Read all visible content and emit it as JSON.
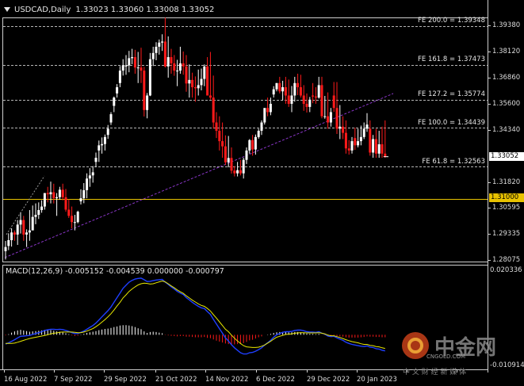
{
  "chart": {
    "symbol_timeframe": "USDCAD,Daily",
    "ohlc": "1.33023 1.33060 1.33008 1.33052"
  },
  "price_axis": {
    "ticks": [
      "1.39380",
      "1.38120",
      "1.36860",
      "1.35600",
      "1.34340",
      "1.31820",
      "1.30595",
      "1.29335",
      "1.28075"
    ],
    "current_price": "1.33052",
    "level_price": "1.31000"
  },
  "fibonacci": [
    {
      "label": "FE 200.0 = 1.39348",
      "price": 1.39348
    },
    {
      "label": "FE 161.8 = 1.37473",
      "price": 1.37473
    },
    {
      "label": "FE 127.2 = 1.35774",
      "price": 1.35774
    },
    {
      "label": "FE 100.0 = 1.34439",
      "price": 1.34439
    },
    {
      "label": "FE 61.8 = 1.32563",
      "price": 1.32563
    }
  ],
  "macd": {
    "label": "MACD(12,26,9) -0.005152 -0.004539 0.000000 -0.000797",
    "top_value": "0.020336",
    "bottom_value": "-0.010914"
  },
  "time_axis": [
    "16 Aug 2022",
    "7 Sep 2022",
    "29 Sep 2022",
    "21 Oct 2022",
    "14 Nov 2022",
    "6 Dec 2022",
    "29 Dec 2022",
    "20 Jan 2023"
  ],
  "watermark": {
    "brand": "中金网",
    "site": "CNGOLD.COM",
    "tagline": "中 文 财 经 新 媒 体"
  },
  "colors": {
    "background": "#000000",
    "bull_body": "#ffffff",
    "bear_body": "#ff1a1a",
    "fib_line": "#b4b4b4",
    "trendline": "#8a36c8",
    "level_line": "#e8c200",
    "macd_line": "#1f3fff",
    "signal_line": "#e8e800",
    "histogram": "#ffffff"
  },
  "chart_data": {
    "type": "candlestick",
    "title": "USDCAD,Daily",
    "ylim": [
      1.279,
      1.401
    ],
    "series": {
      "high": [
        1.2899,
        1.2936,
        1.296,
        1.295,
        1.3,
        1.3035,
        1.302,
        1.2955,
        1.3048,
        1.307,
        1.308,
        1.3085,
        1.3095,
        1.313,
        1.316,
        1.3185,
        1.3175,
        1.313,
        1.316,
        1.3175,
        1.315,
        1.31,
        1.3065,
        1.3025,
        1.3045,
        1.3148,
        1.3178,
        1.3225,
        1.325,
        1.326,
        1.3325,
        1.3383,
        1.3398,
        1.3412,
        1.3458,
        1.352,
        1.3595,
        1.3655,
        1.3742,
        1.3775,
        1.3795,
        1.3815,
        1.3825,
        1.382,
        1.381,
        1.383,
        1.3738,
        1.3612,
        1.3805,
        1.3835,
        1.3857,
        1.387,
        1.3895,
        1.3975,
        1.3885,
        1.3825,
        1.3795,
        1.3772,
        1.3835,
        1.3812,
        1.3795,
        1.375,
        1.371,
        1.3692,
        1.3725,
        1.373,
        1.375,
        1.3785,
        1.381,
        1.3696,
        1.352,
        1.35,
        1.347,
        1.3408,
        1.3405,
        1.335,
        1.326,
        1.328,
        1.329,
        1.33,
        1.335,
        1.339,
        1.341,
        1.3412,
        1.344,
        1.348,
        1.3532,
        1.359,
        1.359,
        1.3645,
        1.366,
        1.369,
        1.3671,
        1.369,
        1.3677,
        1.3646,
        1.369,
        1.3705,
        1.37,
        1.365,
        1.361,
        1.3593,
        1.366,
        1.364,
        1.369,
        1.369,
        1.3598,
        1.3615,
        1.354,
        1.3665,
        1.3665,
        1.3554,
        1.35,
        1.348,
        1.3385,
        1.34,
        1.3445,
        1.344,
        1.3455,
        1.347,
        1.3515,
        1.348,
        1.341,
        1.344,
        1.343,
        1.345,
        1.348
      ],
      "open": [
        1.285,
        1.2875,
        1.2903,
        1.294,
        1.293,
        1.2978,
        1.3,
        1.293,
        1.294,
        1.295,
        1.3015,
        1.3025,
        1.3048,
        1.3065,
        1.313,
        1.3124,
        1.3134,
        1.3105,
        1.311,
        1.3146,
        1.311,
        1.305,
        1.302,
        1.299,
        1.299,
        1.309,
        1.3105,
        1.3144,
        1.32,
        1.3215,
        1.328,
        1.3335,
        1.336,
        1.3366,
        1.341,
        1.347,
        1.355,
        1.361,
        1.366,
        1.372,
        1.374,
        1.3745,
        1.378,
        1.3785,
        1.3735,
        1.3735,
        1.372,
        1.353,
        1.36,
        1.3775,
        1.3805,
        1.3835,
        1.3855,
        1.386,
        1.374,
        1.3785,
        1.3755,
        1.372,
        1.372,
        1.3755,
        1.374,
        1.3658,
        1.3675,
        1.364,
        1.3635,
        1.365,
        1.368,
        1.374,
        1.36,
        1.359,
        1.347,
        1.343,
        1.338,
        1.3355,
        1.3278,
        1.3299,
        1.3238,
        1.3225,
        1.324,
        1.3225,
        1.329,
        1.3335,
        1.3385,
        1.334,
        1.34,
        1.343,
        1.347,
        1.354,
        1.352,
        1.3605,
        1.363,
        1.366,
        1.362,
        1.364,
        1.36,
        1.356,
        1.36,
        1.366,
        1.364,
        1.36,
        1.356,
        1.3545,
        1.36,
        1.3595,
        1.359,
        1.365,
        1.35,
        1.35,
        1.347,
        1.36,
        1.354,
        1.344,
        1.345,
        1.342,
        1.3345,
        1.3335,
        1.3395,
        1.336,
        1.338,
        1.34,
        1.344,
        1.344,
        1.3325,
        1.339,
        1.332,
        1.3365,
        1.332
      ],
      "low": [
        1.281,
        1.2855,
        1.2872,
        1.29,
        1.288,
        1.2935,
        1.29,
        1.287,
        1.29,
        1.2955,
        1.298,
        1.3005,
        1.3035,
        1.305,
        1.3085,
        1.308,
        1.308,
        1.302,
        1.3098,
        1.3095,
        1.304,
        1.301,
        1.296,
        1.295,
        1.2984,
        1.3075,
        1.3081,
        1.3105,
        1.316,
        1.318,
        1.3255,
        1.328,
        1.332,
        1.3335,
        1.3391,
        1.3458,
        1.352,
        1.359,
        1.364,
        1.3696,
        1.37,
        1.3712,
        1.3751,
        1.3705,
        1.366,
        1.366,
        1.3499,
        1.349,
        1.3597,
        1.3742,
        1.377,
        1.3797,
        1.3815,
        1.3735,
        1.3686,
        1.3705,
        1.3695,
        1.3645,
        1.3705,
        1.37,
        1.3618,
        1.359,
        1.359,
        1.357,
        1.36,
        1.3625,
        1.3645,
        1.3607,
        1.358,
        1.344,
        1.3395,
        1.3335,
        1.33,
        1.3265,
        1.3254,
        1.3224,
        1.321,
        1.321,
        1.3215,
        1.32,
        1.327,
        1.332,
        1.331,
        1.3315,
        1.3392,
        1.341,
        1.346,
        1.35,
        1.3505,
        1.359,
        1.362,
        1.361,
        1.3577,
        1.356,
        1.3545,
        1.352,
        1.357,
        1.3602,
        1.359,
        1.3526,
        1.3518,
        1.352,
        1.3563,
        1.356,
        1.3585,
        1.349,
        1.3488,
        1.344,
        1.345,
        1.3521,
        1.3415,
        1.339,
        1.339,
        1.332,
        1.3315,
        1.332,
        1.3338,
        1.335,
        1.336,
        1.339,
        1.3425,
        1.331,
        1.33,
        1.33,
        1.33,
        1.33,
        1.33
      ],
      "close": [
        1.287,
        1.2903,
        1.294,
        1.293,
        1.2978,
        1.3,
        1.293,
        1.294,
        1.295,
        1.3015,
        1.3025,
        1.3048,
        1.3065,
        1.313,
        1.3124,
        1.3134,
        1.3105,
        1.311,
        1.3146,
        1.311,
        1.305,
        1.302,
        1.299,
        1.299,
        1.304,
        1.3105,
        1.3144,
        1.32,
        1.3215,
        1.323,
        1.33,
        1.336,
        1.3366,
        1.34,
        1.344,
        1.351,
        1.359,
        1.364,
        1.372,
        1.3745,
        1.3745,
        1.378,
        1.3785,
        1.3735,
        1.3735,
        1.372,
        1.353,
        1.36,
        1.3775,
        1.3805,
        1.3835,
        1.3855,
        1.386,
        1.374,
        1.3785,
        1.3755,
        1.372,
        1.372,
        1.3755,
        1.374,
        1.3658,
        1.3675,
        1.364,
        1.3635,
        1.365,
        1.368,
        1.374,
        1.36,
        1.359,
        1.347,
        1.343,
        1.338,
        1.3355,
        1.3278,
        1.3299,
        1.3238,
        1.3225,
        1.324,
        1.3225,
        1.329,
        1.3335,
        1.3385,
        1.334,
        1.34,
        1.343,
        1.347,
        1.354,
        1.352,
        1.356,
        1.363,
        1.366,
        1.362,
        1.364,
        1.36,
        1.356,
        1.36,
        1.366,
        1.364,
        1.36,
        1.356,
        1.3545,
        1.358,
        1.3595,
        1.359,
        1.365,
        1.35,
        1.35,
        1.347,
        1.352,
        1.354,
        1.344,
        1.345,
        1.342,
        1.3345,
        1.3335,
        1.338,
        1.336,
        1.338,
        1.34,
        1.344,
        1.346,
        1.3325,
        1.339,
        1.332,
        1.3365,
        1.332,
        1.3305
      ]
    },
    "macd_histogram": [
      -0.0002,
      0.0002,
      0.0007,
      0.0011,
      0.0014,
      0.0016,
      0.0014,
      0.0012,
      0.001,
      0.0011,
      0.0012,
      0.0013,
      0.0014,
      0.0016,
      0.0016,
      0.0015,
      0.0013,
      0.0011,
      0.001,
      0.0008,
      0.0005,
      0.0002,
      -0.0002,
      -0.0004,
      -0.0003,
      0.0001,
      0.0003,
      0.0006,
      0.0008,
      0.001,
      0.0012,
      0.0015,
      0.0017,
      0.0019,
      0.002,
      0.0022,
      0.0025,
      0.0027,
      0.003,
      0.0031,
      0.0031,
      0.003,
      0.0028,
      0.0025,
      0.0021,
      0.0018,
      0.0011,
      0.0006,
      0.0009,
      0.001,
      0.0009,
      0.0007,
      0.0005,
      -0.0001,
      -0.0002,
      -0.0003,
      -0.0004,
      -0.0005,
      -0.0004,
      -0.0004,
      -0.0006,
      -0.0006,
      -0.0007,
      -0.0008,
      -0.0008,
      -0.0008,
      -0.0007,
      -0.001,
      -0.0011,
      -0.0015,
      -0.0019,
      -0.0022,
      -0.0025,
      -0.0028,
      -0.003,
      -0.0031,
      -0.0031,
      -0.003,
      -0.003,
      -0.0027,
      -0.0023,
      -0.0018,
      -0.0016,
      -0.0012,
      -0.0008,
      -0.0005,
      0.0,
      0.0001,
      0.0003,
      0.0006,
      0.0008,
      0.0009,
      0.001,
      0.0009,
      0.0008,
      0.0008,
      0.0009,
      0.0009,
      0.0008,
      0.0006,
      0.0004,
      0.0003,
      0.0003,
      0.0002,
      0.0003,
      0.0,
      -0.0001,
      -0.0003,
      -0.0003,
      -0.0002,
      -0.0004,
      -0.0005,
      -0.0006,
      -0.0008,
      -0.0009,
      -0.0009,
      -0.0009,
      -0.0009,
      -0.0008,
      -0.0007,
      -0.0005,
      -0.0006,
      -0.0006,
      -0.0007,
      -0.0007,
      -0.0008,
      -0.0008
    ],
    "macd_line": [
      -0.003,
      -0.0026,
      -0.0021,
      -0.0016,
      -0.001,
      -0.0005,
      -0.0004,
      -0.0003,
      -0.0002,
      0.0001,
      0.0004,
      0.0007,
      0.001,
      0.0014,
      0.0016,
      0.0018,
      0.0018,
      0.0017,
      0.0018,
      0.0017,
      0.0014,
      0.0011,
      0.0007,
      0.0004,
      0.0004,
      0.0008,
      0.0012,
      0.0018,
      0.0024,
      0.003,
      0.0038,
      0.0048,
      0.0058,
      0.0068,
      0.0078,
      0.009,
      0.0105,
      0.012,
      0.0135,
      0.015,
      0.016,
      0.017,
      0.0176,
      0.018,
      0.0182,
      0.0183,
      0.0178,
      0.0172,
      0.0173,
      0.0175,
      0.0177,
      0.0178,
      0.0179,
      0.017,
      0.0163,
      0.0155,
      0.0148,
      0.014,
      0.0135,
      0.013,
      0.012,
      0.0113,
      0.0105,
      0.0098,
      0.0092,
      0.0087,
      0.0085,
      0.0075,
      0.0066,
      0.005,
      0.0035,
      0.002,
      0.0005,
      -0.001,
      -0.002,
      -0.0032,
      -0.0042,
      -0.005,
      -0.0058,
      -0.0062,
      -0.0062,
      -0.0058,
      -0.0057,
      -0.0053,
      -0.0048,
      -0.0042,
      -0.0033,
      -0.0026,
      -0.0018,
      -0.0008,
      0.0,
      0.0004,
      0.0008,
      0.001,
      0.001,
      0.0011,
      0.0014,
      0.0015,
      0.0015,
      0.0013,
      0.001,
      0.0009,
      0.0009,
      0.0008,
      0.001,
      0.0005,
      0.0002,
      -0.0004,
      -0.0006,
      -0.0005,
      -0.001,
      -0.0014,
      -0.0018,
      -0.0024,
      -0.0028,
      -0.0031,
      -0.0033,
      -0.0035,
      -0.0037,
      -0.0038,
      -0.0036,
      -0.004,
      -0.0041,
      -0.0045,
      -0.0046,
      -0.005,
      -0.0052
    ],
    "signal_line": [
      -0.0028,
      -0.0028,
      -0.0028,
      -0.0027,
      -0.0024,
      -0.0021,
      -0.0018,
      -0.0015,
      -0.0012,
      -0.001,
      -0.0008,
      -0.0006,
      -0.0004,
      -0.0002,
      0.0,
      0.0003,
      0.0005,
      0.0006,
      0.0008,
      0.0009,
      0.0009,
      0.0009,
      0.0009,
      0.0008,
      0.0007,
      0.0007,
      0.0009,
      0.0012,
      0.0016,
      0.002,
      0.0026,
      0.0033,
      0.0041,
      0.0049,
      0.0058,
      0.0068,
      0.008,
      0.0093,
      0.0105,
      0.0119,
      0.0129,
      0.014,
      0.0148,
      0.0155,
      0.0161,
      0.0165,
      0.0167,
      0.0166,
      0.0164,
      0.0165,
      0.0168,
      0.0171,
      0.0174,
      0.0171,
      0.0165,
      0.0158,
      0.0152,
      0.0145,
      0.0139,
      0.0134,
      0.0126,
      0.0119,
      0.0112,
      0.0106,
      0.01,
      0.0095,
      0.0092,
      0.0085,
      0.0077,
      0.0065,
      0.0054,
      0.0042,
      0.003,
      0.0018,
      0.001,
      -0.0001,
      -0.0011,
      -0.002,
      -0.0028,
      -0.0035,
      -0.0039,
      -0.004,
      -0.0041,
      -0.0041,
      -0.004,
      -0.0037,
      -0.0033,
      -0.0027,
      -0.0021,
      -0.0014,
      -0.0008,
      -0.0005,
      -0.0002,
      0.0001,
      0.0002,
      0.0003,
      0.0005,
      0.0006,
      0.0007,
      0.0007,
      0.0006,
      0.0006,
      0.0006,
      0.0006,
      0.0007,
      0.0005,
      0.0003,
      -0.0001,
      -0.0003,
      -0.0003,
      -0.0006,
      -0.0009,
      -0.0012,
      -0.0016,
      -0.0019,
      -0.0022,
      -0.0024,
      -0.0026,
      -0.0029,
      -0.0031,
      -0.0031,
      -0.0034,
      -0.0035,
      -0.0038,
      -0.0039,
      -0.0042,
      -0.0044
    ],
    "macd_ylim": [
      -0.010914,
      0.020336
    ],
    "horizontal_level": 1.31
  }
}
